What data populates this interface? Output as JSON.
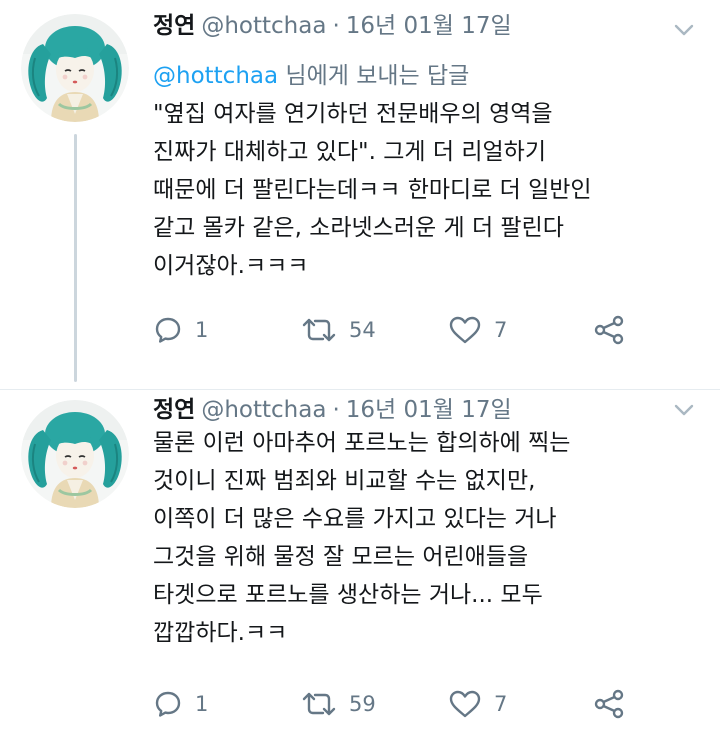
{
  "tweets": [
    {
      "author_name": "정연",
      "handle": "@hottchaa",
      "separator": "·",
      "date": "16년 01월 17일",
      "reply_context": {
        "mention": "@hottchaa",
        "suffix": " 님에게 보내는 답글"
      },
      "lines": [
        "\"옆집 여자를 연기하던 전문배우의 영역을",
        "진짜가 대체하고 있다\". 그게 더 리얼하기",
        "때문에 더 팔린다는데ㅋㅋ 한마디로 더 일반인",
        "같고 몰카 같은, 소라넷스러운 게 더 팔린다",
        "이거잖아.ㅋㅋㅋ"
      ],
      "actions": {
        "replies": "1",
        "retweets": "54",
        "likes": "7"
      }
    },
    {
      "author_name": "정연",
      "handle": "@hottchaa",
      "separator": "·",
      "date": "16년 01월 17일",
      "lines": [
        "물론 이런 아마추어 포르노는 합의하에 찍는",
        "것이니 진짜 범죄와 비교할 수는 없지만,",
        "이쪽이 더 많은 수요를 가지고 있다는 거나",
        "그것을 위해 물정 잘 모르는 어린애들을",
        "타겟으로 포르노를 생산하는 거나... 모두",
        "깝깝하다.ㅋㅋ"
      ],
      "actions": {
        "replies": "1",
        "retweets": "59",
        "likes": "7"
      }
    }
  ],
  "icons": {
    "reply": "reply-icon",
    "retweet": "retweet-icon",
    "like": "heart-icon",
    "share": "share-icon",
    "menu": "chevron-down-icon",
    "avatar": "avatar"
  },
  "colors": {
    "text": "#14171a",
    "secondary": "#657786",
    "link": "#1da1f2",
    "thread_line": "#ccd6dd",
    "divider": "#e6ecf0"
  }
}
